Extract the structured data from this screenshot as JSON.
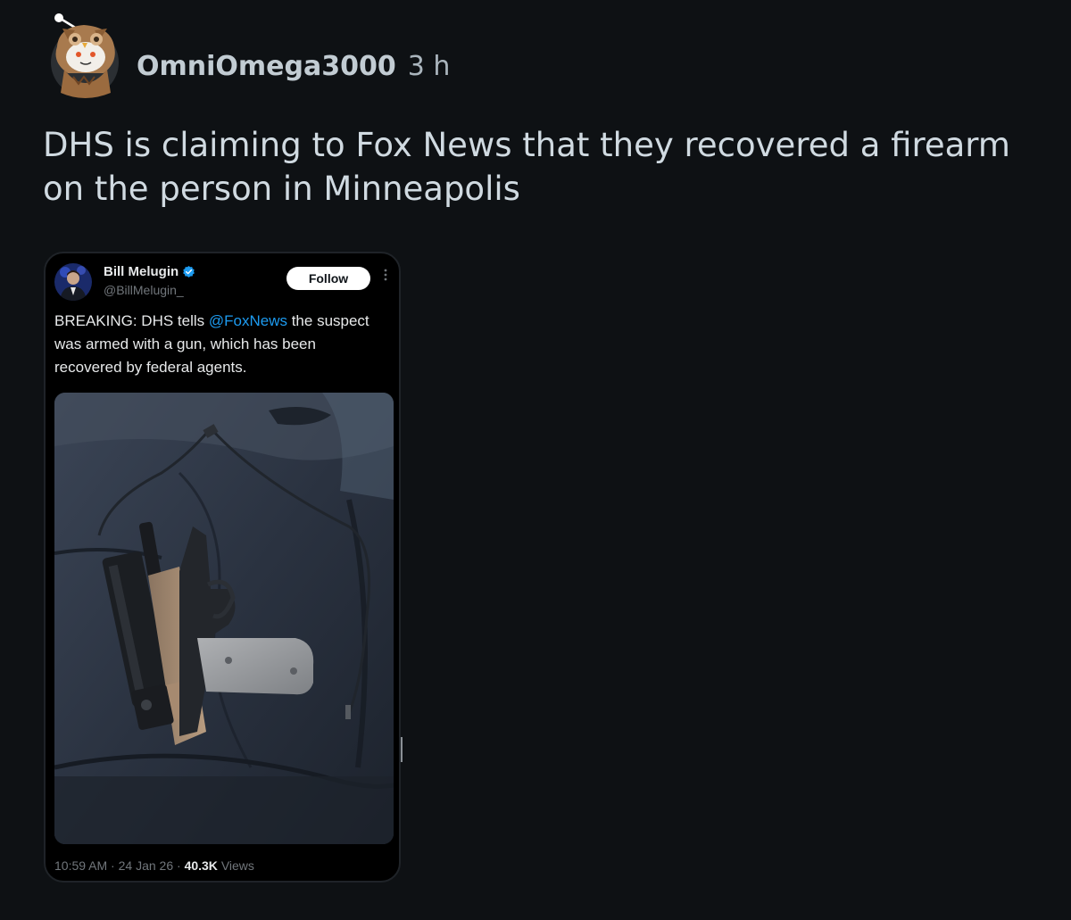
{
  "post": {
    "author": "OmniOmega3000",
    "time_ago": "3 h",
    "title": "DHS is claiming to Fox News that they recovered a firearm on the person in Minneapolis",
    "avatar_icon": "owl-snoo-avatar"
  },
  "tweet": {
    "display_name": "Bill Melugin",
    "handle": "@BillMelugin_",
    "verified": true,
    "follow_label": "Follow",
    "more_icon": "more-vertical-icon",
    "text_before": "BREAKING: DHS tells ",
    "mention": "@FoxNews",
    "text_after": " the suspect was armed with a gun, which has been recovered by federal agents.",
    "image_description_icon": "photo-pistol-on-car-seat",
    "time": "10:59 AM",
    "date": "24 Jan 26",
    "separator": "·",
    "views_count": "40.3K",
    "views_label": "Views"
  },
  "colors": {
    "background": "#0e1114",
    "link": "#1d9bf0",
    "verified": "#1d9bf0"
  }
}
